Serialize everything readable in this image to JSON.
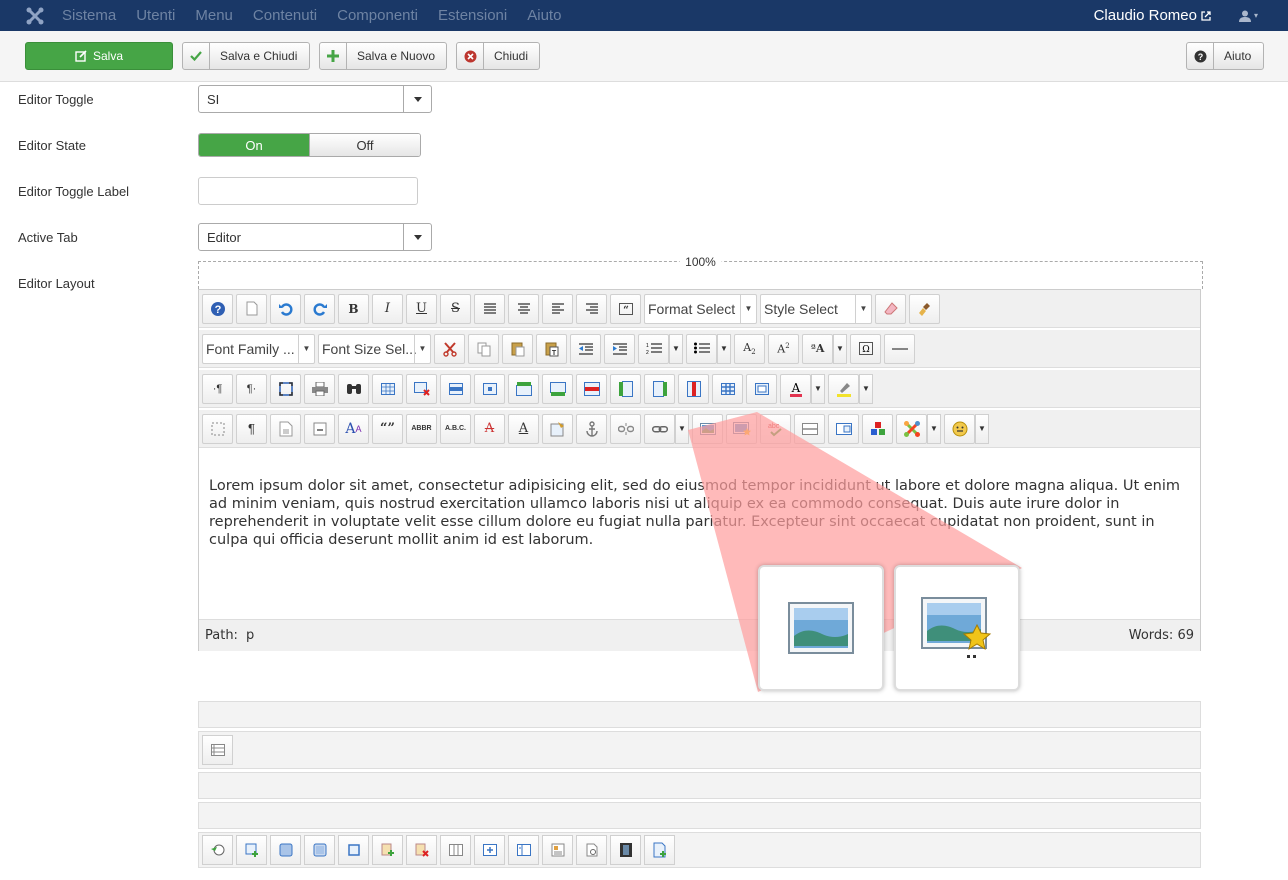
{
  "nav": {
    "items": [
      "Sistema",
      "Utenti",
      "Menu",
      "Contenuti",
      "Componenti",
      "Estensioni",
      "Aiuto"
    ],
    "user": "Claudio Romeo"
  },
  "toolbar": {
    "save": "Salva",
    "save_close": "Salva e Chiudi",
    "save_new": "Salva e Nuovo",
    "close": "Chiudi",
    "help": "Aiuto"
  },
  "form": {
    "editor_toggle": {
      "label": "Editor Toggle",
      "value": "SI"
    },
    "editor_state": {
      "label": "Editor State",
      "on": "On",
      "off": "Off"
    },
    "editor_toggle_label": {
      "label": "Editor Toggle Label",
      "value": ""
    },
    "active_tab": {
      "label": "Active Tab",
      "value": "Editor"
    },
    "editor_layout": {
      "label": "Editor Layout"
    }
  },
  "editor": {
    "width": "100%",
    "format_select": "Format Select",
    "style_select": "Style Select",
    "font_family": "Font Family ...",
    "font_size": "Font Size Sel...",
    "content": "Lorem ipsum dolor sit amet, consectetur adipisicing elit, sed do eiusmod tempor incididunt ut labore et dolore magna aliqua. Ut enim ad minim veniam, quis nostrud exercitation ullamco laboris nisi ut aliquip ex ea commodo consequat. Duis aute irure dolor in reprehenderit in voluptate velit esse cillum dolore eu fugiat nulla pariatur. Excepteur sint occaecat cupidatat non proident, sunt in culpa qui officia deserunt mollit anim id est laborum.",
    "path_label": "Path:",
    "path_value": "p",
    "words": "Words: 69"
  },
  "colors": {
    "navbar": "#1a3867",
    "save_green": "#46a546",
    "zoom_highlight": "#ff9c9c"
  }
}
